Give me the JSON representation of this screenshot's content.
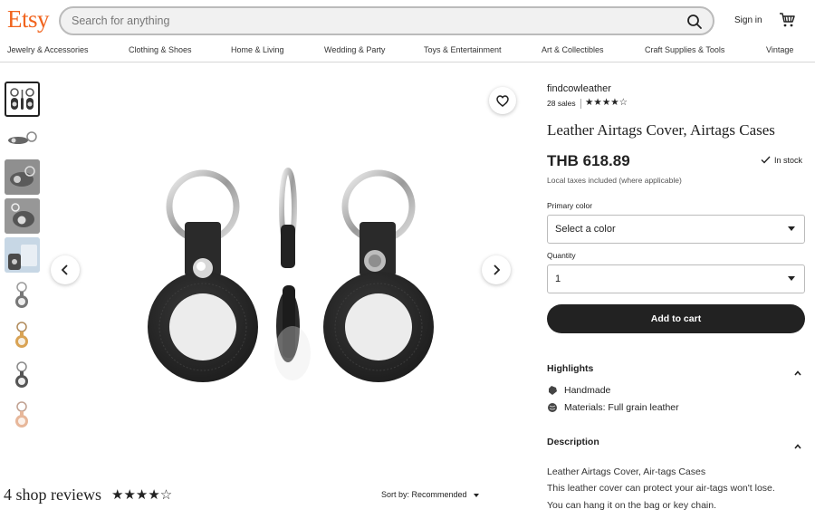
{
  "header": {
    "logo": "Etsy",
    "search_placeholder": "Search for anything",
    "signin_label": "Sign in"
  },
  "nav": {
    "items": [
      "Jewelry & Accessories",
      "Clothing & Shoes",
      "Home & Living",
      "Wedding & Party",
      "Toys & Entertainment",
      "Art & Collectibles",
      "Craft Supplies & Tools",
      "Vintage"
    ]
  },
  "gallery": {
    "thumbnail_count": 9,
    "selected_index": 0
  },
  "reviews": {
    "title": "4 shop reviews",
    "stars": "★★★★☆",
    "sort_label": "Sort by: Recommended"
  },
  "listing": {
    "shop_name": "findcowleather",
    "sales": "28 sales",
    "stars": "★★★★☆",
    "title": "Leather Airtags Cover, Airtags Cases",
    "price": "THB 618.89",
    "stock": "In stock",
    "taxes_note": "Local taxes included (where applicable)",
    "color_label": "Primary color",
    "color_value": "Select a color",
    "quantity_label": "Quantity",
    "quantity_value": "1",
    "add_to_cart": "Add to cart"
  },
  "highlights": {
    "title": "Highlights",
    "items": [
      "Handmade",
      "Materials: Full grain leather"
    ]
  },
  "description": {
    "title": "Description",
    "lines": [
      "Leather Airtags Cover, Air-tags Cases",
      "This leather cover can protect your air-tags won't lose.",
      "You can hang it on the bag or key chain."
    ]
  },
  "colors": {
    "brand": "#f1641e",
    "cart_button": "#222222"
  }
}
